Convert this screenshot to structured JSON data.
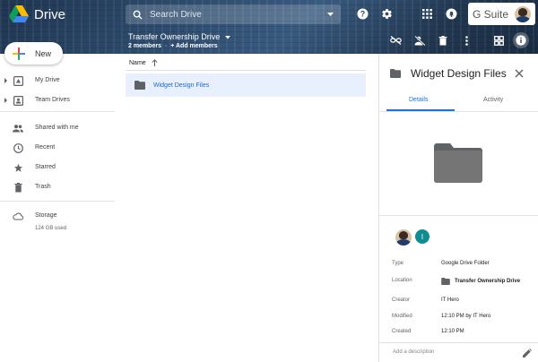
{
  "app": {
    "name": "Drive",
    "suite": "G Suite"
  },
  "search": {
    "placeholder": "Search Drive"
  },
  "shared_drive": {
    "title": "Transfer Ownership Drive",
    "members": "2 members",
    "add_members": "+ Add members"
  },
  "new_button": {
    "label": "New"
  },
  "sidebar": {
    "items": [
      {
        "label": "My Drive",
        "icon": "my-drive-icon"
      },
      {
        "label": "Team Drives",
        "icon": "team-drives-icon"
      },
      {
        "label": "Shared with me",
        "icon": "people-icon"
      },
      {
        "label": "Recent",
        "icon": "clock-icon"
      },
      {
        "label": "Starred",
        "icon": "star-icon"
      },
      {
        "label": "Trash",
        "icon": "trash-icon"
      }
    ],
    "storage": {
      "label": "Storage",
      "used": "124 GB used"
    }
  },
  "file_list": {
    "column_name": "Name",
    "files": [
      {
        "name": "Widget Design Files",
        "type": "folder"
      }
    ]
  },
  "details": {
    "title": "Widget Design Files",
    "tabs": [
      {
        "label": "Details",
        "active": true
      },
      {
        "label": "Activity",
        "active": false
      }
    ],
    "share_initial": "I",
    "rows": [
      {
        "label": "Type",
        "value": "Google Drive Folder"
      },
      {
        "label": "Location",
        "value": "Transfer Ownership Drive"
      },
      {
        "label": "Creator",
        "value": "IT Hero"
      },
      {
        "label": "Modified",
        "value": "12:10 PM by IT Hero"
      },
      {
        "label": "Created",
        "value": "12:10 PM"
      }
    ],
    "description_placeholder": "Add a description"
  },
  "colors": {
    "accent": "#1a73e8",
    "selected_row": "#e8f0fe",
    "folder": "#5f6368",
    "share_badge": "#0f8d91"
  }
}
